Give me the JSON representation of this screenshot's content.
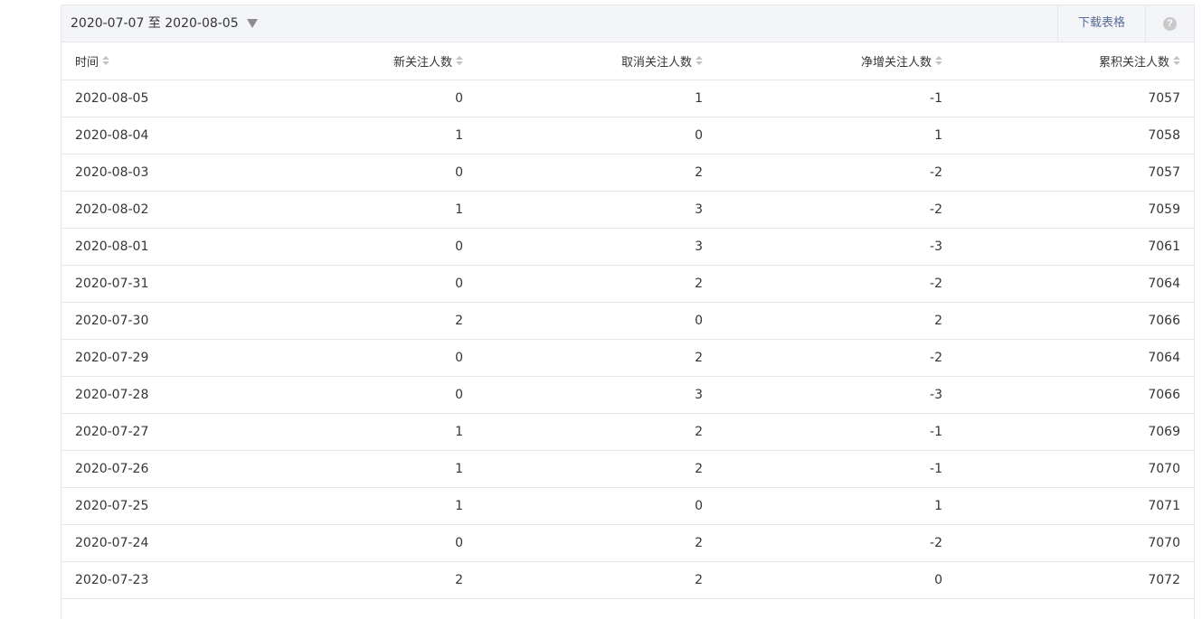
{
  "toolbar": {
    "date_range": "2020-07-07 至 2020-08-05",
    "download_label": "下载表格",
    "help_label": "?"
  },
  "table": {
    "headers": [
      "时间",
      "新关注人数",
      "取消关注人数",
      "净增关注人数",
      "累积关注人数"
    ],
    "rows": [
      [
        "2020-08-05",
        "0",
        "1",
        "-1",
        "7057"
      ],
      [
        "2020-08-04",
        "1",
        "0",
        "1",
        "7058"
      ],
      [
        "2020-08-03",
        "0",
        "2",
        "-2",
        "7057"
      ],
      [
        "2020-08-02",
        "1",
        "3",
        "-2",
        "7059"
      ],
      [
        "2020-08-01",
        "0",
        "3",
        "-3",
        "7061"
      ],
      [
        "2020-07-31",
        "0",
        "2",
        "-2",
        "7064"
      ],
      [
        "2020-07-30",
        "2",
        "0",
        "2",
        "7066"
      ],
      [
        "2020-07-29",
        "0",
        "2",
        "-2",
        "7064"
      ],
      [
        "2020-07-28",
        "0",
        "3",
        "-3",
        "7066"
      ],
      [
        "2020-07-27",
        "1",
        "2",
        "-1",
        "7069"
      ],
      [
        "2020-07-26",
        "1",
        "2",
        "-1",
        "7070"
      ],
      [
        "2020-07-25",
        "1",
        "0",
        "1",
        "7071"
      ],
      [
        "2020-07-24",
        "0",
        "2",
        "-2",
        "7070"
      ],
      [
        "2020-07-23",
        "2",
        "2",
        "0",
        "7072"
      ]
    ]
  },
  "colors": {
    "link": "#576b95",
    "toolbar_bg": "#f4f5f9",
    "border": "#e7e7eb",
    "text": "#353535"
  }
}
